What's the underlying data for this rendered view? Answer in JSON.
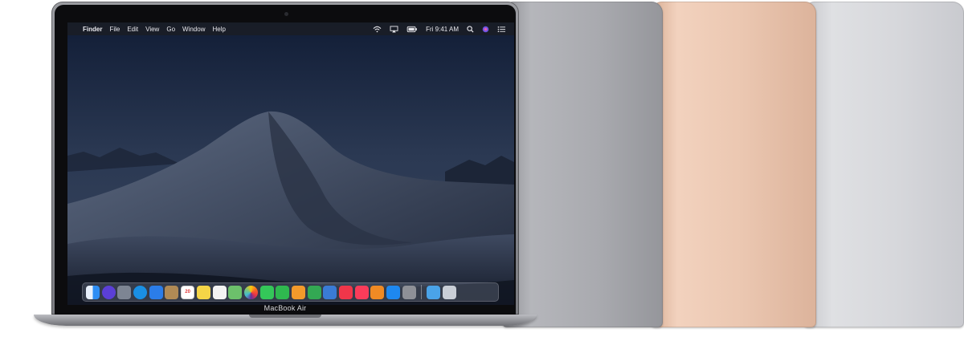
{
  "menubar": {
    "apple_glyph": "",
    "app_name": "Finder",
    "menus": [
      "File",
      "Edit",
      "View",
      "Go",
      "Window",
      "Help"
    ],
    "clock": "Fri 9:41 AM"
  },
  "device": {
    "model_label": "MacBook Air"
  },
  "dock": {
    "apps": [
      {
        "icon": "finder-icon",
        "color": "#2e8ef4"
      },
      {
        "icon": "siri-icon",
        "color": "#5b3fd6"
      },
      {
        "icon": "launchpad-icon",
        "color": "#7d8593"
      },
      {
        "icon": "safari-icon",
        "color": "#1a8fe3"
      },
      {
        "icon": "mail-icon",
        "color": "#2b7de9"
      },
      {
        "icon": "contacts-icon",
        "color": "#b08a55"
      },
      {
        "icon": "calendar-icon",
        "color": "#ffffff",
        "text": "20"
      },
      {
        "icon": "notes-icon",
        "color": "#f5d547"
      },
      {
        "icon": "reminders-icon",
        "color": "#f3f3f3"
      },
      {
        "icon": "maps-icon",
        "color": "#6cc06b"
      },
      {
        "icon": "photos-icon",
        "color": "#f2f2f2"
      },
      {
        "icon": "messages-icon",
        "color": "#34c759"
      },
      {
        "icon": "facetime-icon",
        "color": "#2fb84f"
      },
      {
        "icon": "pages-icon",
        "color": "#f39a2b"
      },
      {
        "icon": "numbers-icon",
        "color": "#33a853"
      },
      {
        "icon": "keynote-icon",
        "color": "#3a7bd5"
      },
      {
        "icon": "news-icon",
        "color": "#f0364a"
      },
      {
        "icon": "music-icon",
        "color": "#fa3c5a"
      },
      {
        "icon": "books-icon",
        "color": "#f08a24"
      },
      {
        "icon": "app-store-icon",
        "color": "#1e88f0"
      },
      {
        "icon": "system-preferences-icon",
        "color": "#8e9097"
      }
    ],
    "stack": [
      {
        "icon": "folder-icon",
        "color": "#4aa3e8"
      },
      {
        "icon": "trash-icon",
        "color": "#c9ced6"
      }
    ]
  },
  "colors": {
    "space_gray": "#a9aaaf",
    "gold": "#ebc7b1",
    "silver": "#d6d7db"
  }
}
